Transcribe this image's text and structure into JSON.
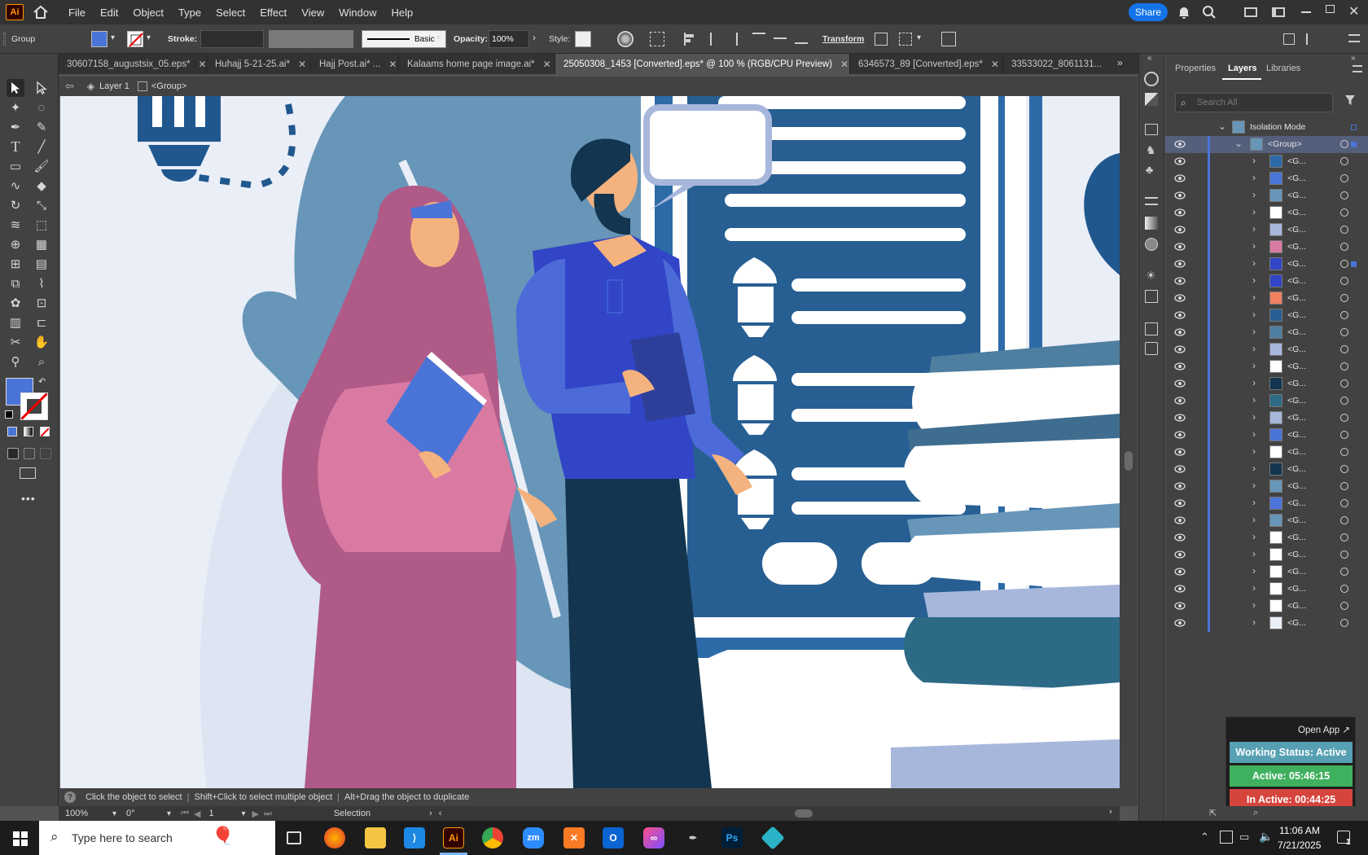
{
  "app": {
    "logo": "Ai",
    "menu": [
      "File",
      "Edit",
      "Object",
      "Type",
      "Select",
      "Effect",
      "View",
      "Window",
      "Help"
    ],
    "share_label": "Share"
  },
  "control_bar": {
    "selection_type": "Group",
    "stroke_label": "Stroke:",
    "brush_label": "Basic",
    "opacity_label": "Opacity:",
    "opacity_value": "100%",
    "style_label": "Style:",
    "transform_label": "Transform",
    "fill_color": "#4b74d8"
  },
  "tabs": [
    {
      "label": "30607158_augustsix_05.eps*",
      "active": false
    },
    {
      "label": "Huhajj 5-21-25.ai*",
      "active": false
    },
    {
      "label": "Hajj Post.ai* ...",
      "active": false
    },
    {
      "label": "Kalaams home page image.ai*",
      "active": false
    },
    {
      "label": "25050308_1453 [Converted].eps* @ 100 % (RGB/CPU Preview)",
      "active": true
    },
    {
      "label": "6346573_89 [Converted].eps*",
      "active": false
    },
    {
      "label": "33533022_8061131...",
      "active": false
    }
  ],
  "breadcrumb": {
    "layer": "Layer 1",
    "group": "<Group>"
  },
  "status": {
    "hint1": "Click the object to select",
    "hint2": "Shift+Click to select multiple object",
    "hint3": "Alt+Drag the object to duplicate",
    "zoom": "100%",
    "rotation": "0°",
    "artboard": "1",
    "tool": "Selection"
  },
  "panel": {
    "tabs": [
      "Properties",
      "Layers",
      "Libraries"
    ],
    "active_tab": "Layers",
    "search_placeholder": "Search All",
    "isolation_label": "Isolation Mode",
    "group_label": "<Group>",
    "sublayer_label": "<G...",
    "sublayer_count": 28
  },
  "widget": {
    "open_app": "Open App",
    "working_status": "Working Status: Active",
    "active_time": "Active: 05:46:15",
    "inactive_time": "In Active: 00:44:25"
  },
  "taskbar": {
    "search_placeholder": "Type here to search",
    "time": "11:06 AM",
    "date": "7/21/2025",
    "notification_count": "1",
    "apps": [
      "firefox-icon",
      "file-explorer-icon",
      "vscode-icon",
      "illustrator-icon",
      "chrome-icon",
      "zoom-icon",
      "xampp-icon",
      "outlook-icon",
      "creative-cloud-icon",
      "pen-tool-icon",
      "photoshop-icon",
      "app-icon"
    ]
  }
}
